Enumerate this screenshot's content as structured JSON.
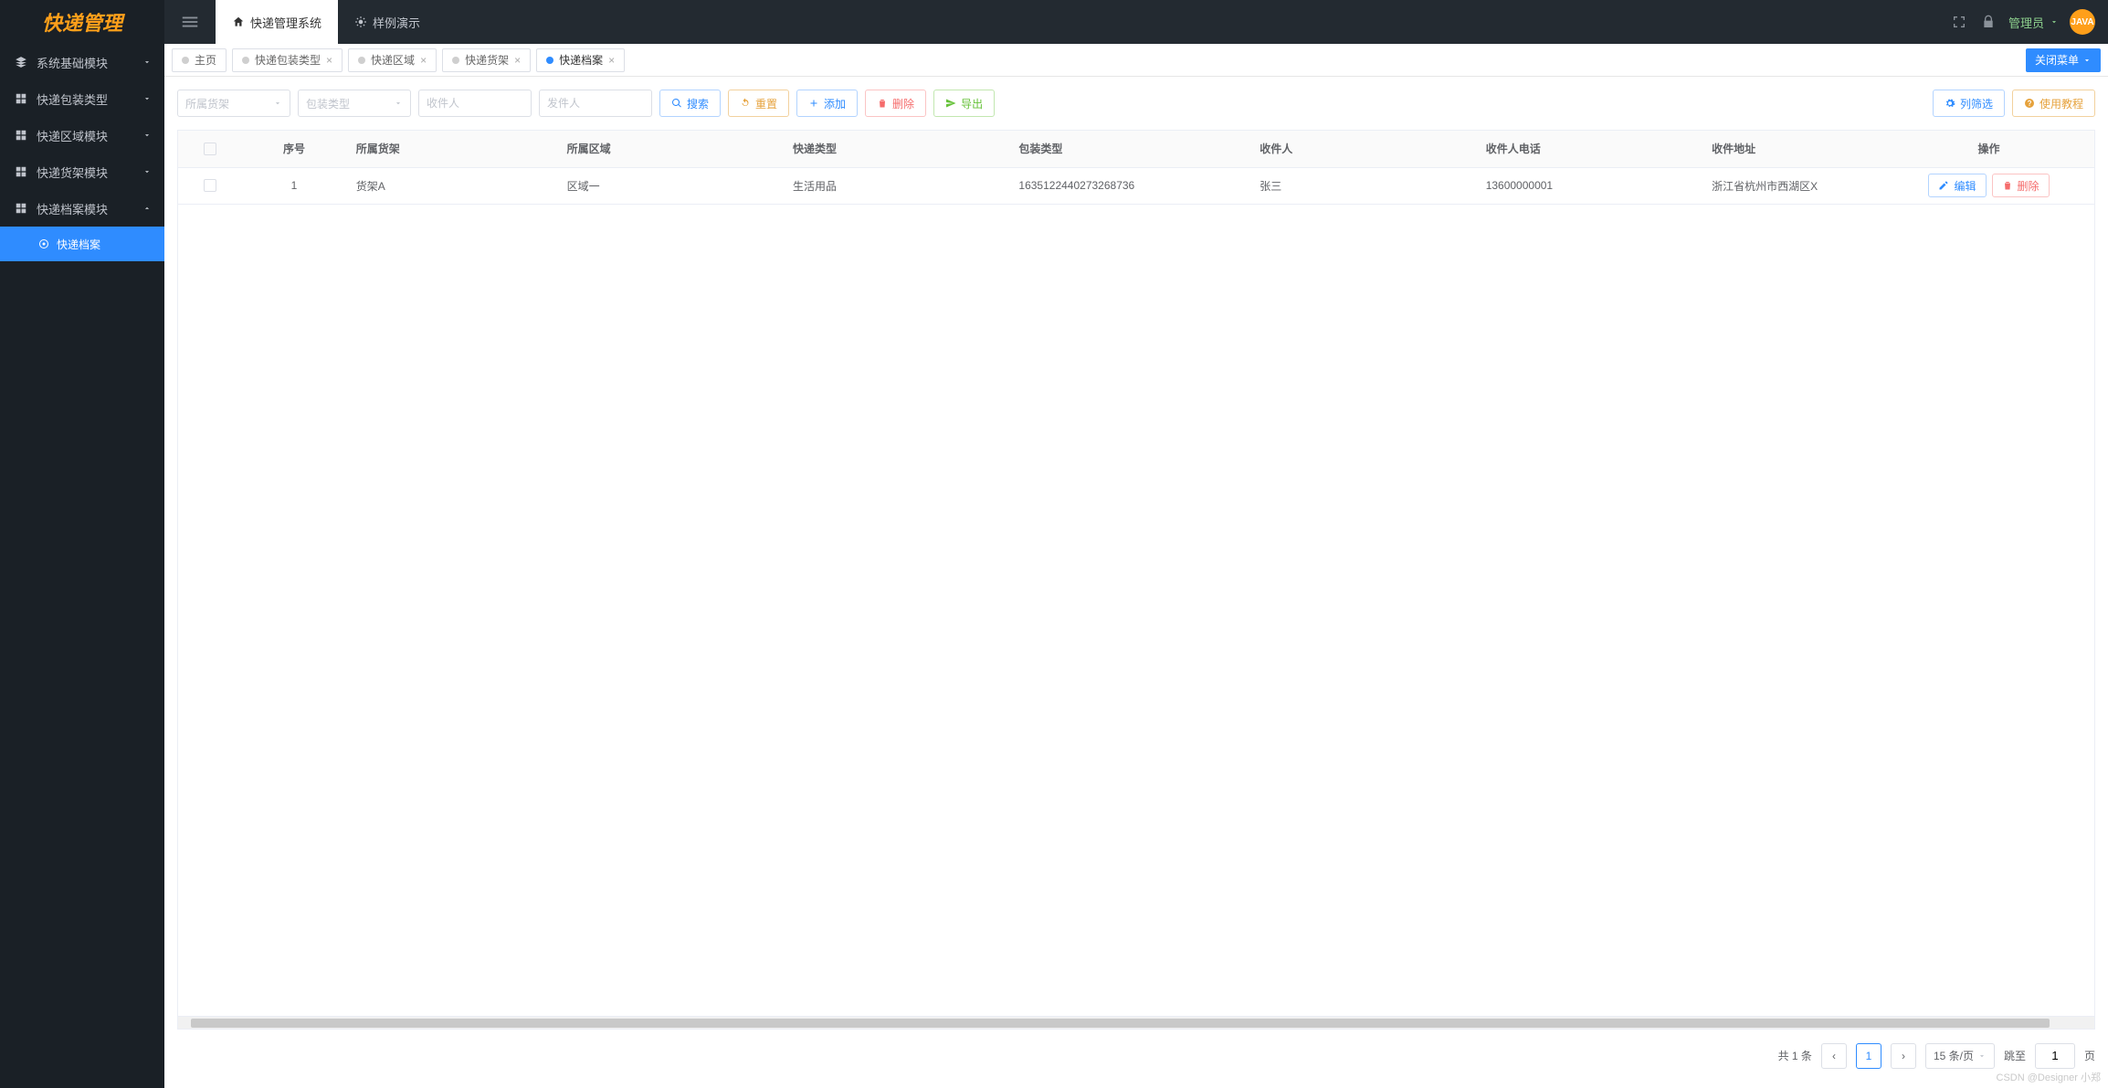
{
  "header": {
    "logo": "快递管理",
    "nav": [
      {
        "label": "快递管理系统",
        "icon": "home"
      },
      {
        "label": "样例演示",
        "icon": "sun"
      }
    ],
    "user_label": "管理员",
    "avatar_text": "JAVA"
  },
  "sidebar": {
    "items": [
      {
        "label": "系统基础模块",
        "icon": "layers"
      },
      {
        "label": "快递包装类型",
        "icon": "grid"
      },
      {
        "label": "快递区域模块",
        "icon": "grid"
      },
      {
        "label": "快递货架模块",
        "icon": "grid"
      },
      {
        "label": "快递档案模块",
        "icon": "grid"
      }
    ],
    "sub_label": "快递档案"
  },
  "tabs": {
    "items": [
      {
        "label": "主页",
        "closable": false
      },
      {
        "label": "快递包装类型",
        "closable": true
      },
      {
        "label": "快递区域",
        "closable": true
      },
      {
        "label": "快递货架",
        "closable": true
      },
      {
        "label": "快递档案",
        "closable": true,
        "active": true
      }
    ],
    "close_menu": "关闭菜单"
  },
  "filters": {
    "shelf_ph": "所属货架",
    "pack_ph": "包装类型",
    "recv_ph": "收件人",
    "send_ph": "发件人"
  },
  "buttons": {
    "search": "搜索",
    "reset": "重置",
    "add": "添加",
    "delete": "删除",
    "export": "导出",
    "col_filter": "列筛选",
    "tutorial": "使用教程",
    "edit": "编辑",
    "row_delete": "删除"
  },
  "table": {
    "headers": {
      "idx": "序号",
      "shelf": "所属货架",
      "area": "所属区域",
      "type": "快递类型",
      "pack": "包装类型",
      "recv": "收件人",
      "phone": "收件人电话",
      "addr": "收件地址",
      "op": "操作"
    },
    "rows": [
      {
        "idx": "1",
        "shelf": "货架A",
        "area": "区域一",
        "type": "生活用品",
        "pack": "1635122440273268736",
        "recv": "张三",
        "phone": "13600000001",
        "addr": "浙江省杭州市西湖区X"
      }
    ]
  },
  "pager": {
    "total_tpl": "共 1 条",
    "page": "1",
    "size": "15 条/页",
    "goto": "跳至",
    "goto_val": "1",
    "page_unit": "页"
  },
  "watermark": "CSDN @Designer 小郑"
}
